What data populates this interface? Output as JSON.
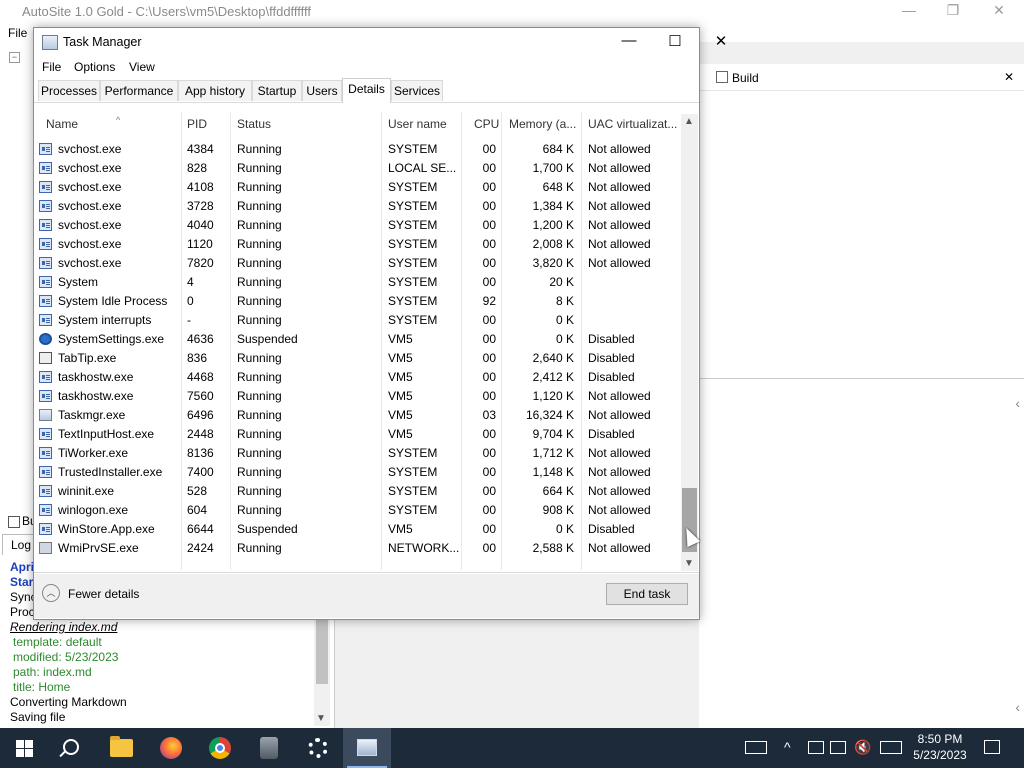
{
  "background_app": {
    "title": "AutoSite 1.0 Gold - C:\\Users\\vm5\\Desktop\\ffddffffff",
    "minimize": "—",
    "restore": "❐",
    "close": "✕",
    "menu_file": "File",
    "build_tab": "Build",
    "build_close": "✕",
    "log_tab_partial": "Bu",
    "log_tab": "Log",
    "log_lines": [
      {
        "text": "Apri",
        "style": "bold"
      },
      {
        "text": "Star",
        "style": "bold"
      },
      {
        "text": "Sync",
        "style": "normal"
      },
      {
        "text": "Proc",
        "style": "normal"
      },
      {
        "text": "Rendering index.md",
        "style": "italic"
      },
      {
        "text": "template: default",
        "style": "green"
      },
      {
        "text": "modified: 5/23/2023",
        "style": "green"
      },
      {
        "text": "path: index.md",
        "style": "green"
      },
      {
        "text": "title: Home",
        "style": "green"
      },
      {
        "text": "Converting Markdown",
        "style": "normal"
      },
      {
        "text": "Saving file",
        "style": "normal"
      }
    ]
  },
  "task_manager": {
    "title": "Task Manager",
    "minimize": "—",
    "maximize": "☐",
    "close": "✕",
    "menu": [
      "File",
      "Options",
      "View"
    ],
    "tabs": [
      "Processes",
      "Performance",
      "App history",
      "Startup",
      "Users",
      "Details",
      "Services"
    ],
    "active_tab": "Details",
    "columns": {
      "name": "Name",
      "pid": "PID",
      "status": "Status",
      "user": "User name",
      "cpu": "CPU",
      "memory": "Memory (a...",
      "uac": "UAC virtualizat..."
    },
    "rows": [
      {
        "name": "svchost.exe",
        "pid": "4384",
        "status": "Running",
        "user": "SYSTEM",
        "cpu": "00",
        "memory": "684 K",
        "uac": "Not allowed",
        "icon": "service-icon"
      },
      {
        "name": "svchost.exe",
        "pid": "828",
        "status": "Running",
        "user": "LOCAL SE...",
        "cpu": "00",
        "memory": "1,700 K",
        "uac": "Not allowed",
        "icon": "service-icon"
      },
      {
        "name": "svchost.exe",
        "pid": "4108",
        "status": "Running",
        "user": "SYSTEM",
        "cpu": "00",
        "memory": "648 K",
        "uac": "Not allowed",
        "icon": "service-icon"
      },
      {
        "name": "svchost.exe",
        "pid": "3728",
        "status": "Running",
        "user": "SYSTEM",
        "cpu": "00",
        "memory": "1,384 K",
        "uac": "Not allowed",
        "icon": "service-icon"
      },
      {
        "name": "svchost.exe",
        "pid": "4040",
        "status": "Running",
        "user": "SYSTEM",
        "cpu": "00",
        "memory": "1,200 K",
        "uac": "Not allowed",
        "icon": "service-icon"
      },
      {
        "name": "svchost.exe",
        "pid": "1120",
        "status": "Running",
        "user": "SYSTEM",
        "cpu": "00",
        "memory": "2,008 K",
        "uac": "Not allowed",
        "icon": "service-icon"
      },
      {
        "name": "svchost.exe",
        "pid": "7820",
        "status": "Running",
        "user": "SYSTEM",
        "cpu": "00",
        "memory": "3,820 K",
        "uac": "Not allowed",
        "icon": "service-icon"
      },
      {
        "name": "System",
        "pid": "4",
        "status": "Running",
        "user": "SYSTEM",
        "cpu": "00",
        "memory": "20 K",
        "uac": "",
        "icon": "service-icon"
      },
      {
        "name": "System Idle Process",
        "pid": "0",
        "status": "Running",
        "user": "SYSTEM",
        "cpu": "92",
        "memory": "8 K",
        "uac": "",
        "icon": "service-icon"
      },
      {
        "name": "System interrupts",
        "pid": "-",
        "status": "Running",
        "user": "SYSTEM",
        "cpu": "00",
        "memory": "0 K",
        "uac": "",
        "icon": "service-icon"
      },
      {
        "name": "SystemSettings.exe",
        "pid": "4636",
        "status": "Suspended",
        "user": "VM5",
        "cpu": "00",
        "memory": "0 K",
        "uac": "Disabled",
        "icon": "gear-icon"
      },
      {
        "name": "TabTip.exe",
        "pid": "836",
        "status": "Running",
        "user": "VM5",
        "cpu": "00",
        "memory": "2,640 K",
        "uac": "Disabled",
        "icon": "keyboard-icon"
      },
      {
        "name": "taskhostw.exe",
        "pid": "4468",
        "status": "Running",
        "user": "VM5",
        "cpu": "00",
        "memory": "2,412 K",
        "uac": "Disabled",
        "icon": "service-icon"
      },
      {
        "name": "taskhostw.exe",
        "pid": "7560",
        "status": "Running",
        "user": "VM5",
        "cpu": "00",
        "memory": "1,120 K",
        "uac": "Not allowed",
        "icon": "service-icon"
      },
      {
        "name": "Taskmgr.exe",
        "pid": "6496",
        "status": "Running",
        "user": "VM5",
        "cpu": "03",
        "memory": "16,324 K",
        "uac": "Not allowed",
        "icon": "task-manager-icon"
      },
      {
        "name": "TextInputHost.exe",
        "pid": "2448",
        "status": "Running",
        "user": "VM5",
        "cpu": "00",
        "memory": "9,704 K",
        "uac": "Disabled",
        "icon": "service-icon"
      },
      {
        "name": "TiWorker.exe",
        "pid": "8136",
        "status": "Running",
        "user": "SYSTEM",
        "cpu": "00",
        "memory": "1,712 K",
        "uac": "Not allowed",
        "icon": "service-icon"
      },
      {
        "name": "TrustedInstaller.exe",
        "pid": "7400",
        "status": "Running",
        "user": "SYSTEM",
        "cpu": "00",
        "memory": "1,148 K",
        "uac": "Not allowed",
        "icon": "service-icon"
      },
      {
        "name": "wininit.exe",
        "pid": "528",
        "status": "Running",
        "user": "SYSTEM",
        "cpu": "00",
        "memory": "664 K",
        "uac": "Not allowed",
        "icon": "service-icon"
      },
      {
        "name": "winlogon.exe",
        "pid": "604",
        "status": "Running",
        "user": "SYSTEM",
        "cpu": "00",
        "memory": "908 K",
        "uac": "Not allowed",
        "icon": "service-icon"
      },
      {
        "name": "WinStore.App.exe",
        "pid": "6644",
        "status": "Suspended",
        "user": "VM5",
        "cpu": "00",
        "memory": "0 K",
        "uac": "Disabled",
        "icon": "service-icon"
      },
      {
        "name": "WmiPrvSE.exe",
        "pid": "2424",
        "status": "Running",
        "user": "NETWORK...",
        "cpu": "00",
        "memory": "2,588 K",
        "uac": "Not allowed",
        "icon": "wmi-icon"
      }
    ],
    "fewer_details": "Fewer details",
    "end_task": "End task"
  },
  "taskbar": {
    "apps": [
      "start-icon",
      "search-icon",
      "file-explorer-icon",
      "firefox-icon",
      "chrome-icon",
      "jar-app-icon",
      "settings-gear-icon",
      "task-manager-icon"
    ],
    "active_app": "task-manager-icon",
    "time": "8:50 PM",
    "date": "5/23/2023"
  }
}
